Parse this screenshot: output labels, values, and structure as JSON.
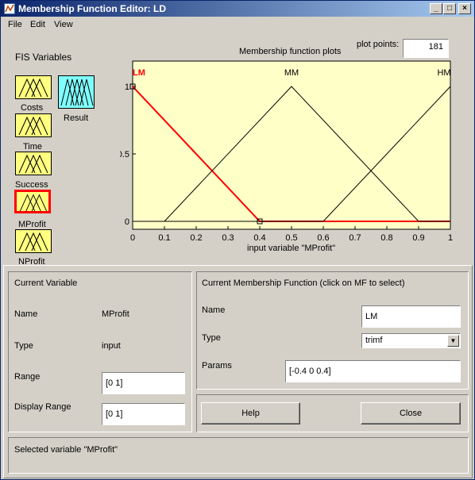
{
  "window": {
    "title": "Membership Function Editor: LD"
  },
  "menu": {
    "file": "File",
    "edit": "Edit",
    "view": "View"
  },
  "fis": {
    "heading": "FIS Variables",
    "inputs": [
      "Costs",
      "Time",
      "Success",
      "MProfit",
      "NProfit"
    ],
    "output": "Result",
    "selected": "MProfit"
  },
  "plot": {
    "title": "Membership function plots",
    "points_label": "plot points:",
    "points_value": "181",
    "xlabel": "input variable \"MProfit\""
  },
  "chart_data": {
    "type": "line",
    "title": "Membership function plots",
    "xlabel": "input variable \"MProfit\"",
    "ylabel": "",
    "xlim": [
      0,
      1
    ],
    "ylim": [
      0,
      1
    ],
    "x_ticks": [
      "0",
      "0.1",
      "0.2",
      "0.3",
      "0.4",
      "0.5",
      "0.6",
      "0.7",
      "0.8",
      "0.9",
      "1"
    ],
    "y_ticks": [
      "0",
      "0.5",
      "1"
    ],
    "series": [
      {
        "name": "LM",
        "color": "#ff0000",
        "selected": true,
        "x": [
          -0.4,
          0,
          0.4,
          1
        ],
        "y": [
          0,
          1,
          0,
          0
        ]
      },
      {
        "name": "MM",
        "color": "#000000",
        "selected": false,
        "x": [
          0,
          0.1,
          0.5,
          0.9,
          1
        ],
        "y": [
          0,
          0,
          1,
          0,
          0
        ]
      },
      {
        "name": "HM",
        "color": "#000000",
        "selected": false,
        "x": [
          0,
          0.6,
          1
        ],
        "y": [
          0,
          0,
          1
        ]
      }
    ]
  },
  "current_variable": {
    "heading": "Current Variable",
    "name_label": "Name",
    "name_value": "MProfit",
    "type_label": "Type",
    "type_value": "input",
    "range_label": "Range",
    "range_value": "[0 1]",
    "display_range_label": "Display Range",
    "display_range_value": "[0 1]"
  },
  "current_mf": {
    "heading": "Current Membership Function (click on MF to select)",
    "name_label": "Name",
    "name_value": "LM",
    "type_label": "Type",
    "type_value": "trimf",
    "params_label": "Params",
    "params_value": "[-0.4 0 0.4]"
  },
  "buttons": {
    "help": "Help",
    "close": "Close"
  },
  "status": "Selected variable \"MProfit\""
}
